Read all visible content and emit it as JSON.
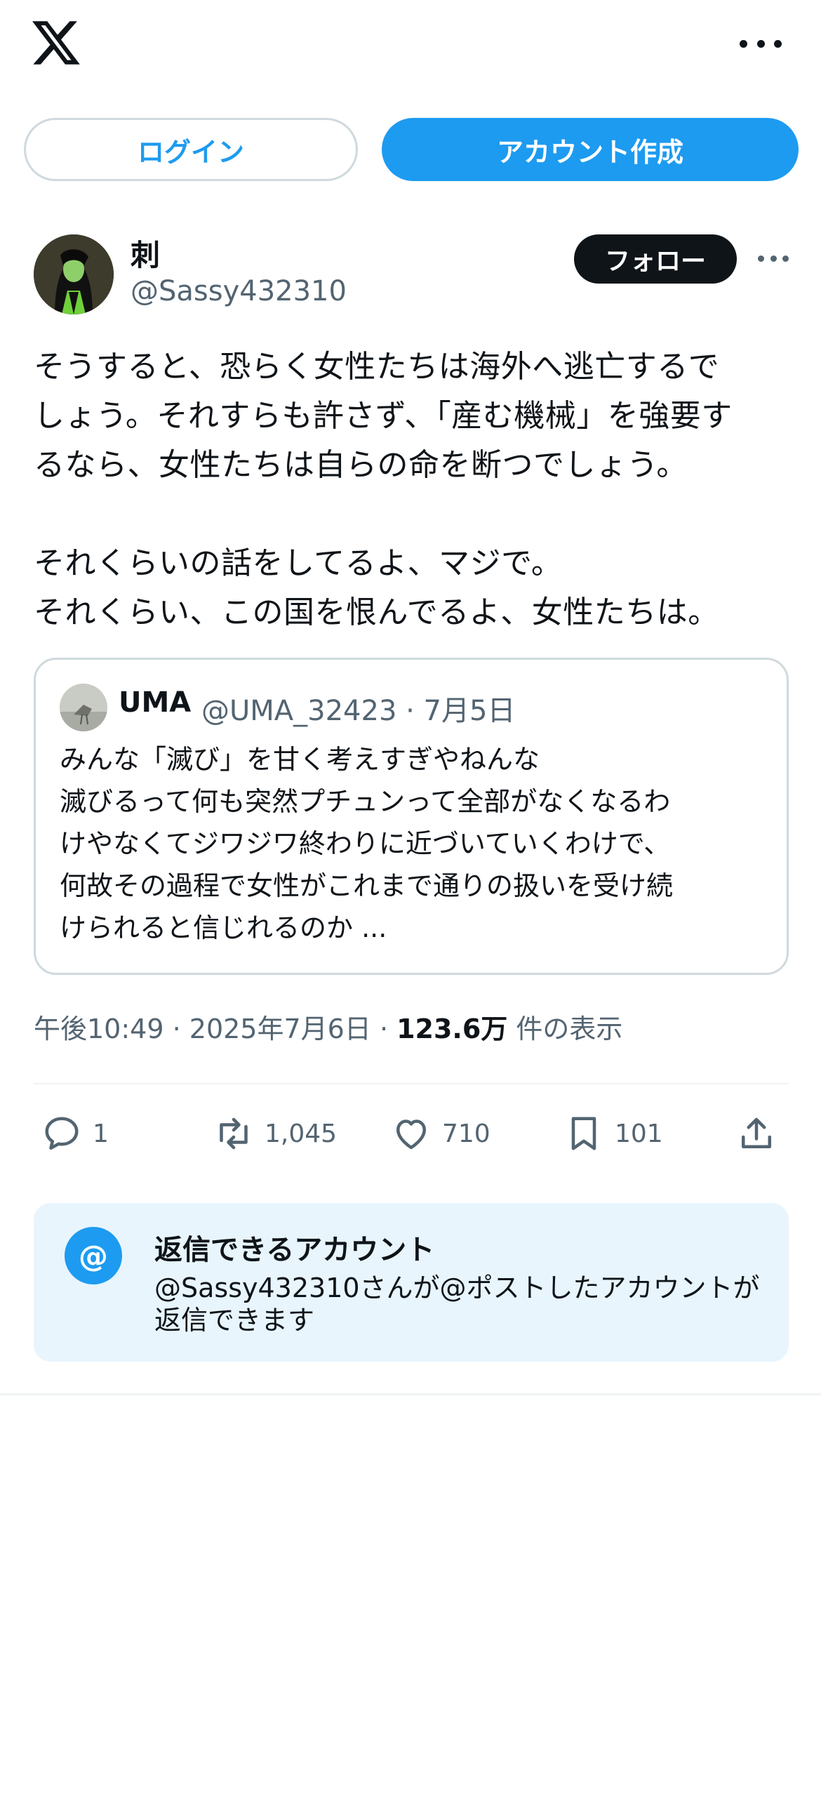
{
  "header": {
    "logo_icon": "x-logo-icon",
    "more_icon": "more-horizontal-icon"
  },
  "auth": {
    "login_label": "ログイン",
    "signup_label": "アカウント作成"
  },
  "post": {
    "author_name": "刺",
    "author_handle": "@Sassy432310",
    "follow_label": "フォロー",
    "text": "そうすると、恐らく女性たちは海外へ逃亡するで\nしょう。それすらも許さず、「産む機械」を強要す\nるなら、女性たちは自らの命を断つでしょう。\n\nそれくらいの話をしてるよ、マジで。\nそれくらい、この国を恨んでるよ、女性たちは。",
    "time": "午後10:49",
    "date": "2025年7月6日",
    "views": "123.6万",
    "views_label": "件の表示"
  },
  "quote": {
    "name": "UMA",
    "handle_date": "@UMA_32423 · 7月5日",
    "text": "みんな「滅び」を甘く考えすぎやねんな\n滅びるって何も突然プチュンって全部がなくなるわ\nけやなくてジワジワ終わりに近づいていくわけで、\n何故その過程で女性がこれまで通りの扱いを受け続\nけられると信じれるのか ..."
  },
  "actions": {
    "reply_count": "1",
    "repost_count": "1,045",
    "like_count": "710",
    "bookmark_count": "101"
  },
  "reply_restriction": {
    "icon_label": "@",
    "title": "返信できるアカウント",
    "description": "@Sassy432310さんが@ポストしたアカウントが返信できます"
  },
  "colors": {
    "accent": "#1d9bf0",
    "text": "#0f1419",
    "secondary": "#536471",
    "reply_bg": "#e8f5fd"
  }
}
